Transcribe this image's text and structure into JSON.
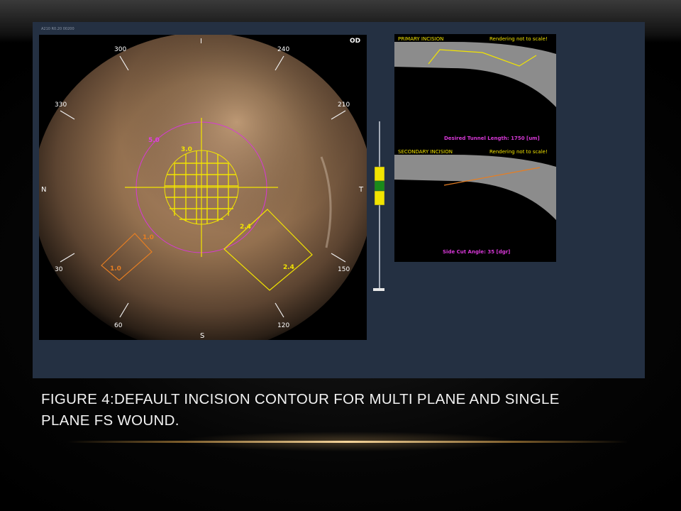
{
  "slide": {
    "caption_line1": "FIGURE 4:DEFAULT INCISION CONTOUR FOR MULTI PLANE AND SINGLE",
    "caption_line2": "PLANE FS WOUND."
  },
  "screen": {
    "id_text": "A210 R0.20 00200",
    "eye_label": "OD"
  },
  "eye_view": {
    "orientation": {
      "top": "I",
      "bottom": "S",
      "left": "N",
      "right": "T"
    },
    "clock_labels": [
      "300",
      "240",
      "330",
      "210",
      "30",
      "150",
      "60",
      "120"
    ],
    "rings": {
      "outer": "5.0",
      "inner": "3.0"
    },
    "primary_incision": {
      "side_a": "2.4",
      "side_b": "2.4"
    },
    "secondary_incision": {
      "side_a": "1.0",
      "side_b": "1.0"
    }
  },
  "primary_panel": {
    "title": "PRIMARY INCISION",
    "note": "Rendering not to scale!",
    "footer": "Desired Tunnel Length:  1750 [um]"
  },
  "secondary_panel": {
    "title": "SECONDARY INCISION",
    "note": "Rendering not to scale!",
    "footer": "Side Cut Angle:  35 [dgr]"
  },
  "colors": {
    "screen_bg": "#243042",
    "yellow": "#f2e400",
    "magenta": "#d838d8",
    "orange": "#e67e22",
    "cornea_gray": "#8c8c8c"
  }
}
